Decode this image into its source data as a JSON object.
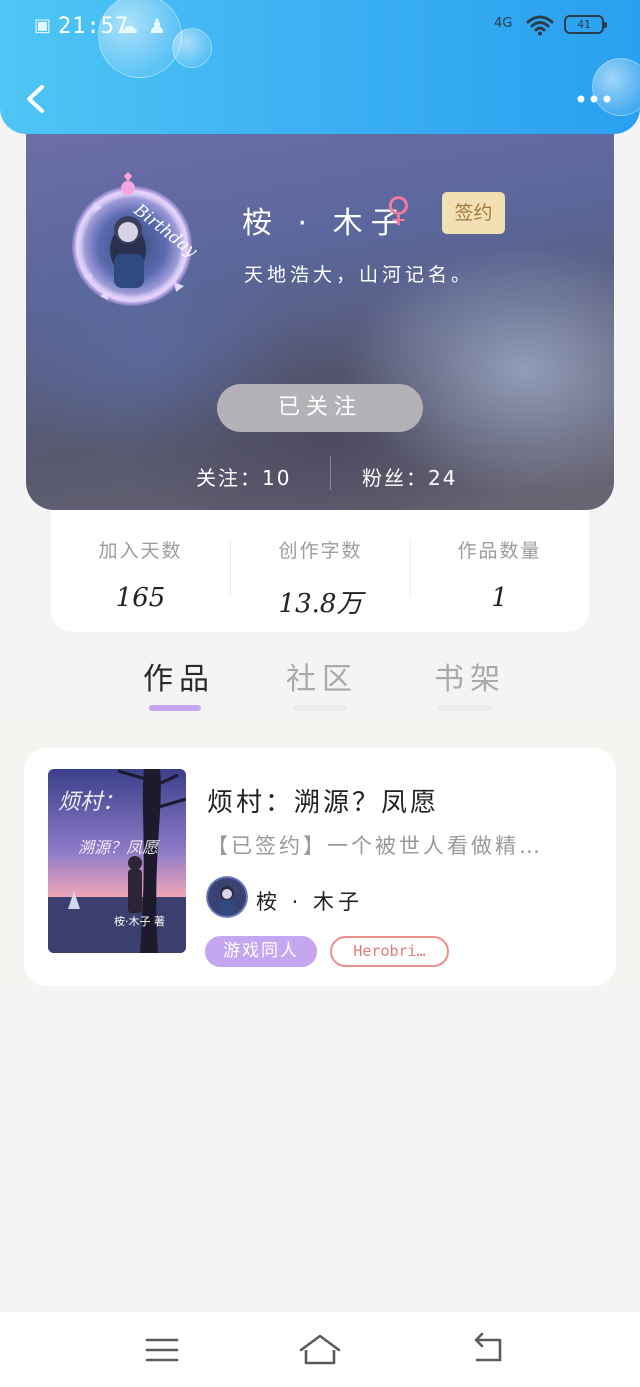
{
  "status_bar": {
    "time": "21:57",
    "network": "4G",
    "battery": "41"
  },
  "header": {
    "back_icon": "chevron-left-icon",
    "more_icon": "more-dots-icon"
  },
  "profile": {
    "avatar_badge_text": "Birthday",
    "nickname": "桉 · 木子",
    "gender_symbol": "♀",
    "sign_badge": "签约",
    "motto": "天地浩大，山河记名。",
    "follow_button": "已关注",
    "following": "关注：10",
    "fans": "粉丝：24"
  },
  "stats": [
    {
      "label": "加入天数",
      "value": "165"
    },
    {
      "label": "创作字数",
      "value": "13.8万"
    },
    {
      "label": "作品数量",
      "value": "1"
    }
  ],
  "tabs": [
    {
      "label": "作品",
      "active": true
    },
    {
      "label": "社区",
      "active": false
    },
    {
      "label": "书架",
      "active": false
    }
  ],
  "works": [
    {
      "title": "烦村：溯源？凤愿",
      "description": "【已签约】一个被世人看做精…",
      "author": "桉 · 木子",
      "tags": [
        "游戏同人",
        "Herobri…"
      ]
    }
  ],
  "colors": {
    "header_blue": "#3db2f3",
    "accent_purple": "#c5a6f0",
    "tag_red": "#ec8f8f",
    "sign_gold": "#f2dfb4"
  }
}
